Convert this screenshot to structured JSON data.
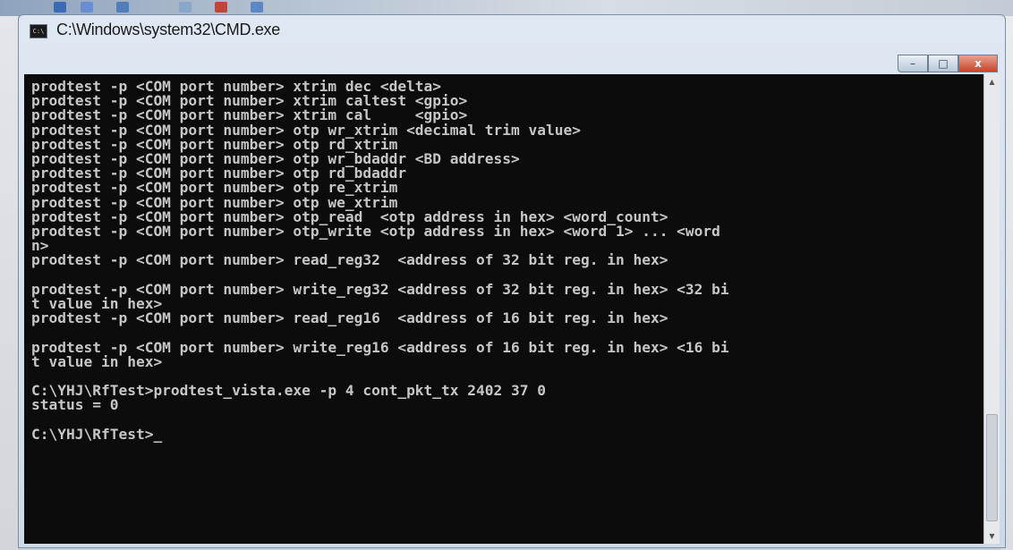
{
  "window": {
    "title": "C:\\Windows\\system32\\CMD.exe",
    "icon_label": "C:\\"
  },
  "controls": {
    "minimize": "–",
    "maximize": "□",
    "close": "x"
  },
  "console": {
    "lines": [
      "prodtest -p <COM port number> xtrim dec <delta>",
      "prodtest -p <COM port number> xtrim caltest <gpio>",
      "prodtest -p <COM port number> xtrim cal     <gpio>",
      "prodtest -p <COM port number> otp wr_xtrim <decimal trim value>",
      "prodtest -p <COM port number> otp rd_xtrim",
      "prodtest -p <COM port number> otp wr_bdaddr <BD address>",
      "prodtest -p <COM port number> otp rd_bdaddr",
      "prodtest -p <COM port number> otp re_xtrim",
      "prodtest -p <COM port number> otp we_xtrim",
      "prodtest -p <COM port number> otp_read  <otp address in hex> <word_count>",
      "prodtest -p <COM port number> otp_write <otp address in hex> <word 1> ... <word",
      "n>",
      "prodtest -p <COM port number> read_reg32  <address of 32 bit reg. in hex>",
      "",
      "prodtest -p <COM port number> write_reg32 <address of 32 bit reg. in hex> <32 bi",
      "t value in hex>",
      "prodtest -p <COM port number> read_reg16  <address of 16 bit reg. in hex>",
      "",
      "prodtest -p <COM port number> write_reg16 <address of 16 bit reg. in hex> <16 bi",
      "t value in hex>",
      "",
      "C:\\YHJ\\RfTest>prodtest_vista.exe -p 4 cont_pkt_tx 2402 37 0",
      "status = 0",
      "",
      "C:\\YHJ\\RfTest>"
    ],
    "cursor": "_"
  }
}
